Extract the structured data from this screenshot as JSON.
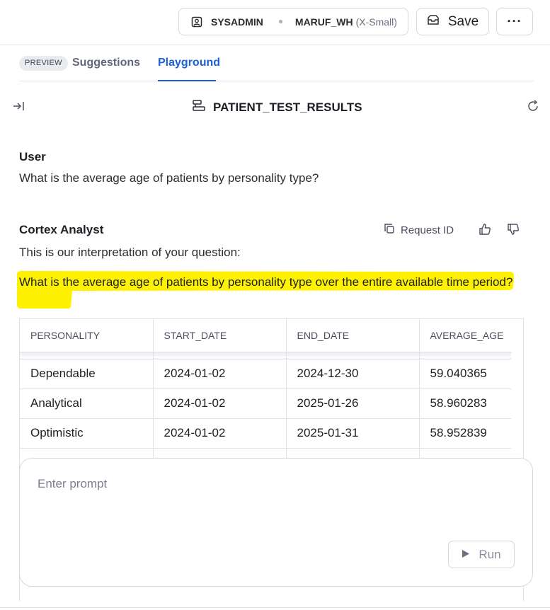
{
  "toolbar": {
    "role": "SYSADMIN",
    "warehouse": "MARUF_WH",
    "warehouse_size": "(X-Small)",
    "save_label": "Save",
    "more_label": "···"
  },
  "tabs": {
    "badge": "PREVIEW",
    "items": [
      {
        "label": "Suggestions",
        "active": false
      },
      {
        "label": "Playground",
        "active": true
      }
    ]
  },
  "panel": {
    "title": "PATIENT_TEST_RESULTS"
  },
  "conversation": {
    "user_label": "User",
    "user_message": "What is the average age of patients by personality type?",
    "analyst_label": "Cortex Analyst",
    "request_id_label": "Request ID",
    "interpretation_intro": "This is our interpretation of your question:",
    "interpretation": "What is the average age of patients by personality type over the entire available time period?"
  },
  "table": {
    "columns": [
      "PERSONALITY",
      "START_DATE",
      "END_DATE",
      "AVERAGE_AGE"
    ],
    "rows": [
      [
        "Dependable",
        "2024-01-02",
        "2024-12-30",
        "59.040365"
      ],
      [
        "Analytical",
        "2024-01-02",
        "2025-01-26",
        "58.960283"
      ],
      [
        "Optimistic",
        "2024-01-02",
        "2025-01-31",
        "58.952839"
      ],
      [
        "",
        "",
        "",
        ""
      ]
    ]
  },
  "prompt": {
    "placeholder": "Enter prompt",
    "run_label": "Run"
  },
  "colors": {
    "accent": "#1a60d9",
    "highlight": "#fff200"
  }
}
